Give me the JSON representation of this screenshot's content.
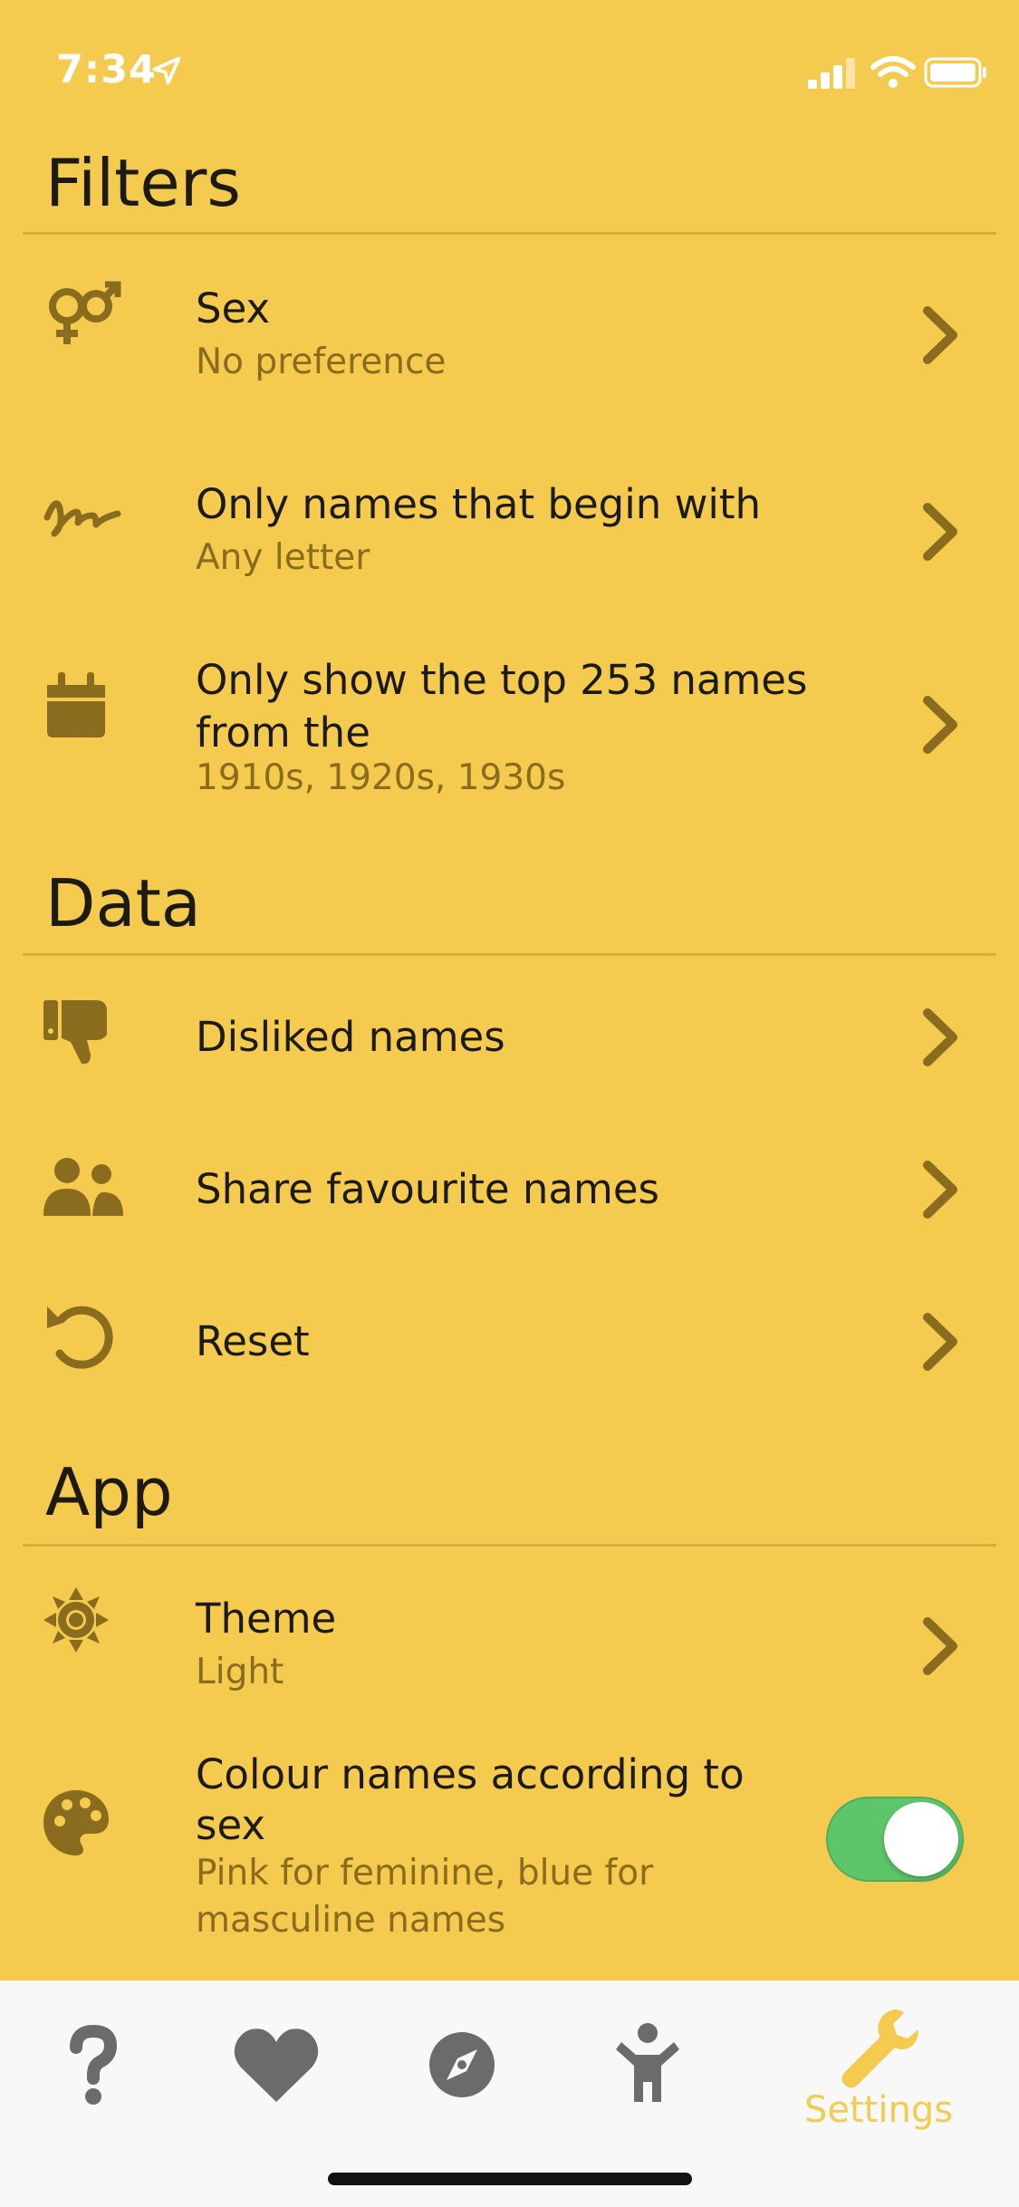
{
  "status": {
    "time": "7:34"
  },
  "sections": {
    "filters": {
      "title": "Filters",
      "sex": {
        "label": "Sex",
        "value": "No preference"
      },
      "begin": {
        "label": "Only names that begin with",
        "value": "Any letter"
      },
      "top": {
        "label_line1": "Only show the top 253 names",
        "label_line2": "from the",
        "value": "1910s, 1920s, 1930s"
      }
    },
    "data": {
      "title": "Data",
      "disliked": {
        "label": "Disliked names"
      },
      "share": {
        "label": "Share favourite names"
      },
      "reset": {
        "label": "Reset"
      }
    },
    "app": {
      "title": "App",
      "theme": {
        "label": "Theme",
        "value": "Light"
      },
      "colour": {
        "label_line1": "Colour names according to",
        "label_line2": "sex",
        "sub_line1": "Pink for feminine, blue for",
        "sub_line2": "masculine names",
        "enabled": true
      }
    }
  },
  "tabs": [
    {
      "icon": "question-icon"
    },
    {
      "icon": "heart-icon"
    },
    {
      "icon": "compass-icon"
    },
    {
      "icon": "child-icon"
    },
    {
      "icon": "wrench-icon",
      "label": "Settings",
      "active": true
    }
  ],
  "colors": {
    "background": "#F4CB4E",
    "icon": "#8A6C1E",
    "toggle_on": "#5DC66B",
    "tab_active": "#F4CB4E",
    "tab_inactive": "#6B6B6B"
  }
}
